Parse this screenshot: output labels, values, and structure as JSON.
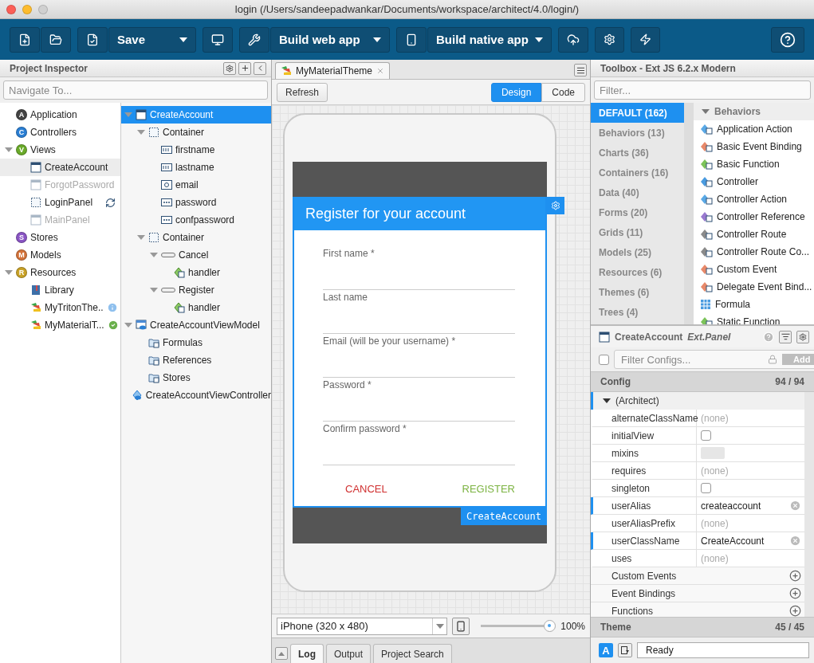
{
  "window": {
    "title": "login (/Users/sandeepadwankar/Documents/workspace/architect/4.0/login/)"
  },
  "toolbar": {
    "save": "Save",
    "build_web": "Build web app",
    "build_native": "Build native app"
  },
  "inspector": {
    "title": "Project Inspector",
    "search_placeholder": "Navigate To...",
    "tree": [
      {
        "label": "Application",
        "kind": "letter",
        "letter": "A",
        "color": "#444444",
        "selected": false,
        "disabled": false
      },
      {
        "label": "Controllers",
        "kind": "letter",
        "letter": "C",
        "color": "#2a7fd4",
        "selected": false,
        "disabled": false
      },
      {
        "label": "Views",
        "kind": "letter",
        "letter": "V",
        "color": "#6aaa2a",
        "selected": false,
        "disabled": false,
        "expanded": true,
        "children": [
          {
            "label": "CreateAccount",
            "kind": "panel",
            "selected": true,
            "disabled": false
          },
          {
            "label": "ForgotPassword",
            "kind": "panel",
            "selected": false,
            "disabled": true
          },
          {
            "label": "LoginPanel",
            "kind": "container",
            "selected": false,
            "disabled": false
          },
          {
            "label": "MainPanel",
            "kind": "panel",
            "selected": false,
            "disabled": true
          }
        ]
      },
      {
        "label": "Stores",
        "kind": "letter",
        "letter": "S",
        "color": "#8a55c4",
        "selected": false,
        "disabled": false
      },
      {
        "label": "Models",
        "kind": "letter",
        "letter": "M",
        "color": "#d4733a",
        "selected": false,
        "disabled": false
      },
      {
        "label": "Resources",
        "kind": "letter",
        "letter": "R",
        "color": "#c9a227",
        "selected": false,
        "disabled": false,
        "expanded": true,
        "children": [
          {
            "label": "Library",
            "kind": "library",
            "selected": false,
            "disabled": false
          },
          {
            "label": "MyTritonThe..",
            "kind": "theme",
            "selected": false,
            "disabled": false
          },
          {
            "label": "MyMaterialT...",
            "kind": "theme",
            "selected": false,
            "disabled": false
          }
        ]
      }
    ],
    "components": [
      {
        "label": "CreateAccount",
        "kind": "panel",
        "selected": true,
        "expanded": true,
        "children": [
          {
            "label": "Container",
            "kind": "container",
            "selected": false,
            "expanded": true,
            "children": [
              {
                "label": "firstname",
                "kind": "textfield",
                "selected": false
              },
              {
                "label": "lastname",
                "kind": "textfield",
                "selected": false
              },
              {
                "label": "email",
                "kind": "email",
                "selected": false
              },
              {
                "label": "password",
                "kind": "password",
                "selected": false
              },
              {
                "label": "confpassword",
                "kind": "password",
                "selected": false
              }
            ]
          },
          {
            "label": "Container",
            "kind": "container",
            "selected": false,
            "expanded": true,
            "children": [
              {
                "label": "Cancel",
                "kind": "button",
                "selected": false,
                "expanded": true,
                "children": [
                  {
                    "label": "handler",
                    "kind": "function",
                    "selected": false
                  }
                ]
              },
              {
                "label": "Register",
                "kind": "button",
                "selected": false,
                "expanded": true,
                "children": [
                  {
                    "label": "handler",
                    "kind": "function",
                    "selected": false
                  }
                ]
              }
            ]
          }
        ]
      },
      {
        "label": "CreateAccountViewModel",
        "kind": "viewmodel",
        "selected": false,
        "expanded": true,
        "children": [
          {
            "label": "Formulas",
            "kind": "folder",
            "selected": false
          },
          {
            "label": "References",
            "kind": "folder",
            "selected": false
          },
          {
            "label": "Stores",
            "kind": "folder",
            "selected": false
          }
        ]
      },
      {
        "label": "CreateAccountViewController",
        "kind": "viewcontroller",
        "selected": false
      }
    ]
  },
  "editor": {
    "tab": "MyMaterialTheme",
    "refresh": "Refresh",
    "modes": [
      {
        "label": "Design",
        "selected": true
      },
      {
        "label": "Code",
        "selected": false
      }
    ],
    "form": {
      "title": "Register for your account",
      "fields": [
        "First name *",
        "Last name",
        "Email (will be your username) *",
        "Password *",
        "Confirm password *"
      ],
      "cancel": "CANCEL",
      "register": "REGISTER",
      "component_label": "CreateAccount"
    },
    "device": "iPhone (320 x 480)",
    "zoom": {
      "level": 0.93,
      "reading": "100%"
    },
    "bottom_tabs": [
      {
        "label": "Log",
        "selected": true
      },
      {
        "label": "Output",
        "selected": false
      },
      {
        "label": "Project Search",
        "selected": false
      }
    ]
  },
  "toolbox": {
    "title": "Toolbox - Ext JS 6.2.x Modern",
    "filter_placeholder": "Filter...",
    "categories": [
      {
        "label": "DEFAULT (162)",
        "selected": true
      },
      {
        "label": "Behaviors (13)",
        "selected": false
      },
      {
        "label": "Charts (36)",
        "selected": false
      },
      {
        "label": "Containers (16)",
        "selected": false
      },
      {
        "label": "Data (40)",
        "selected": false
      },
      {
        "label": "Forms (20)",
        "selected": false
      },
      {
        "label": "Grids (11)",
        "selected": false
      },
      {
        "label": "Models (25)",
        "selected": false
      },
      {
        "label": "Resources (6)",
        "selected": false
      },
      {
        "label": "Themes (6)",
        "selected": false
      },
      {
        "label": "Trees (4)",
        "selected": false
      }
    ],
    "section": "Behaviors",
    "items": [
      {
        "label": "Application Action",
        "kind": "diamond",
        "color": "#5aa9e6"
      },
      {
        "label": "Basic Event Binding",
        "kind": "diamond",
        "color": "#e8896a"
      },
      {
        "label": "Basic Function",
        "kind": "diamond",
        "color": "#7cc35a"
      },
      {
        "label": "Controller",
        "kind": "diamond",
        "color": "#4a9be0"
      },
      {
        "label": "Controller Action",
        "kind": "diamond",
        "color": "#5aa9e6"
      },
      {
        "label": "Controller Reference",
        "kind": "diamond",
        "color": "#9a7ad0"
      },
      {
        "label": "Controller Route",
        "kind": "diamond",
        "color": "#8a8a8a"
      },
      {
        "label": "Controller Route Co...",
        "kind": "diamond",
        "color": "#8a8a8a"
      },
      {
        "label": "Custom Event",
        "kind": "diamond",
        "color": "#e8896a"
      },
      {
        "label": "Delegate Event Bind...",
        "kind": "diamond",
        "color": "#e8896a"
      },
      {
        "label": "Formula",
        "kind": "grid",
        "color": "#4a9be0"
      },
      {
        "label": "Static Function",
        "kind": "diamond",
        "color": "#7cc35a"
      }
    ]
  },
  "config": {
    "title": "CreateAccount",
    "type": "Ext.Panel",
    "select_all": {
      "checked": false
    },
    "filter_placeholder": "Filter Configs...",
    "add": "Add",
    "header": "Config",
    "count": "94 / 94",
    "group": "(Architect)",
    "rows": [
      {
        "name": "alternateClassName",
        "kind": "none",
        "value": "(none)",
        "modified": false
      },
      {
        "name": "initialView",
        "kind": "checkbox",
        "checked": false,
        "modified": false
      },
      {
        "name": "mixins",
        "kind": "object",
        "modified": false
      },
      {
        "name": "requires",
        "kind": "none",
        "value": "(none)",
        "modified": false
      },
      {
        "name": "singleton",
        "kind": "checkbox",
        "checked": false,
        "modified": false
      },
      {
        "name": "userAlias",
        "kind": "text",
        "value": "createaccount",
        "modified": true
      },
      {
        "name": "userAliasPrefix",
        "kind": "none",
        "value": "(none)",
        "modified": false
      },
      {
        "name": "userClassName",
        "kind": "text",
        "value": "CreateAccount",
        "modified": true
      },
      {
        "name": "uses",
        "kind": "none",
        "value": "(none)",
        "modified": false
      }
    ],
    "sections": [
      "Custom Events",
      "Event Bindings",
      "Functions"
    ],
    "theme": "Theme",
    "theme_count": "45 / 45",
    "auto": "A",
    "status": "Ready"
  }
}
